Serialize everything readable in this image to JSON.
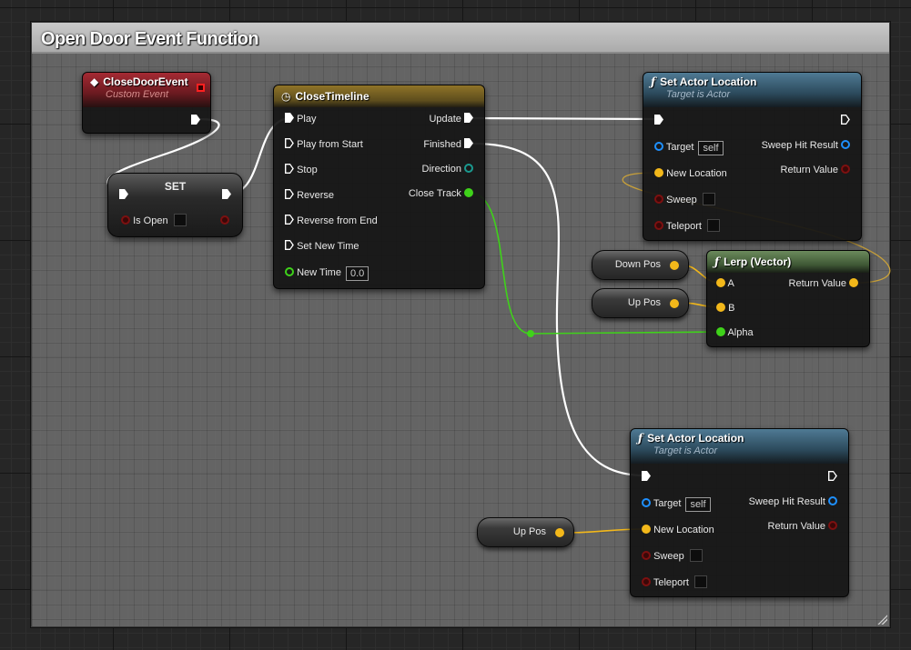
{
  "comment": {
    "title": "Open Door Event Function"
  },
  "nodes": {
    "close_door_event": {
      "title": "CloseDoorEvent",
      "subtitle": "Custom Event"
    },
    "set": {
      "title": "SET",
      "pin_is_open": "Is Open"
    },
    "close_timeline": {
      "title": "CloseTimeline",
      "inputs": [
        "Play",
        "Play from Start",
        "Stop",
        "Reverse",
        "Reverse from End",
        "Set New Time"
      ],
      "new_time_label": "New Time",
      "new_time_value": "0.0",
      "outputs": {
        "update": "Update",
        "finished": "Finished",
        "direction": "Direction",
        "close_track": "Close Track"
      }
    },
    "set_actor_location_1": {
      "title": "Set Actor Location",
      "subtitle": "Target is Actor",
      "target": "Target",
      "target_value": "self",
      "new_location": "New Location",
      "sweep": "Sweep",
      "teleport": "Teleport",
      "sweep_hit_result": "Sweep Hit Result",
      "return_value": "Return Value"
    },
    "lerp": {
      "title": "Lerp (Vector)",
      "a": "A",
      "b": "B",
      "alpha": "Alpha",
      "return_value": "Return Value"
    },
    "down_pos": {
      "label": "Down Pos"
    },
    "up_pos_1": {
      "label": "Up Pos"
    },
    "set_actor_location_2": {
      "title": "Set Actor Location",
      "subtitle": "Target is Actor",
      "target": "Target",
      "target_value": "self",
      "new_location": "New Location",
      "sweep": "Sweep",
      "teleport": "Teleport",
      "sweep_hit_result": "Sweep Hit Result",
      "return_value": "Return Value"
    },
    "up_pos_2": {
      "label": "Up Pos"
    }
  },
  "colors": {
    "exec_wire": "#ffffff",
    "float_wire": "#3fd21a",
    "vector_wire": "#f3b81a",
    "event_header": "#a52a33",
    "timeline_header": "#8f7428",
    "function_header": "#4f7a94",
    "pure_header": "#6b8a5c"
  }
}
